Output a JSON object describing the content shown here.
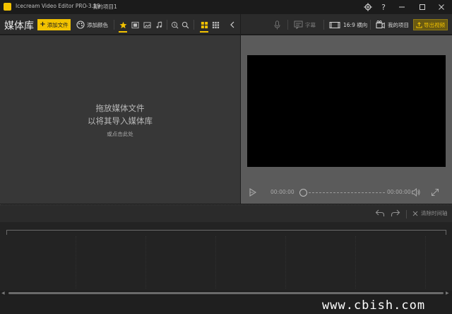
{
  "window": {
    "app_title": "Icecream Video Editor PRO 3.19",
    "separator": "-",
    "project_name": "我的项目1"
  },
  "toolbar": {
    "library_title": "媒体库",
    "add_file_label": "添加文件",
    "add_color_label": "添加颜色",
    "subtitles_label": "字幕",
    "aspect_ratio_label": "16:9 横向",
    "my_projects_label": "我的项目",
    "export_label": "导出视频"
  },
  "media_library": {
    "drop_line1": "拖放媒体文件",
    "drop_line2": "以将其导入媒体库",
    "drop_hint": "或点击此处"
  },
  "preview": {
    "current_time": "00:00:00",
    "total_time": "00:00:00"
  },
  "timeline_bar": {
    "clear_label": "清除时间轴"
  },
  "watermark": {
    "text": "www.cbish.com"
  },
  "colors": {
    "accent": "#f2c200",
    "panel_dark": "#373737",
    "preview_bg": "#5b5b5b",
    "video_bg": "#000000"
  },
  "icons": {
    "app": "app-logo-icon",
    "settings": "gear-icon",
    "help": "question-icon",
    "minimize": "minimize-icon",
    "maximize": "maximize-icon",
    "close": "close-icon"
  }
}
